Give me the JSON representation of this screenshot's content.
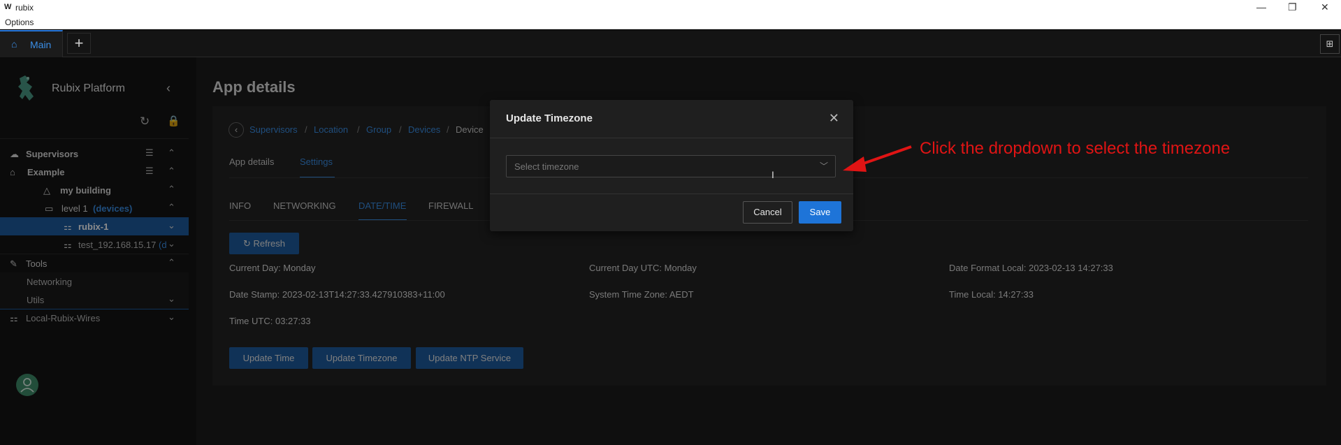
{
  "window": {
    "logo": "W",
    "title": "rubix",
    "minimize": "—",
    "restore": "❐",
    "close": "✕"
  },
  "menu": {
    "options": "Options"
  },
  "tabs": {
    "main_label": "Main",
    "add_label": "+",
    "layout_label": "⊞"
  },
  "sidebar": {
    "brand": "Rubix Platform",
    "items": [
      {
        "label": "Supervisors"
      },
      {
        "label": "Example"
      },
      {
        "label": "my building"
      },
      {
        "label": "level 1",
        "suffix": "(devices)"
      },
      {
        "label": "rubix-1"
      },
      {
        "label": "test_192.168.15.17",
        "suffix": "(d"
      },
      {
        "label": "Tools"
      },
      {
        "label": "Networking"
      },
      {
        "label": "Utils"
      },
      {
        "label": "Local-Rubix-Wires"
      }
    ]
  },
  "page": {
    "title": "App details",
    "breadcrumb": [
      "Supervisors",
      "Location",
      "Group",
      "Devices",
      "Device"
    ],
    "sep": "/",
    "tabs": [
      "App details",
      "Settings"
    ],
    "subtabs": [
      "INFO",
      "NETWORKING",
      "DATE/TIME",
      "FIREWALL"
    ],
    "refresh": "Refresh",
    "fields": {
      "current_day": "Current Day:  Monday",
      "current_day_utc": "Current Day UTC:  Monday",
      "date_format_local": "Date Format Local:  2023-02-13 14:27:33",
      "date_stamp": "Date Stamp:  2023-02-13T14:27:33.427910383+11:00",
      "system_time_zone": "System Time Zone:  AEDT",
      "time_local": "Time Local:  14:27:33",
      "time_utc": "Time UTC:  03:27:33"
    },
    "actions": [
      "Update Time",
      "Update Timezone",
      "Update NTP Service"
    ]
  },
  "modal": {
    "title": "Update Timezone",
    "placeholder": "Select timezone",
    "cancel": "Cancel",
    "save": "Save"
  },
  "annotation": "Click the dropdown to select the timezone",
  "colors": {
    "accent": "#3a8ee6",
    "active_row": "#1e5b9e",
    "primary": "#1e74d8",
    "annotation": "#e01414"
  }
}
